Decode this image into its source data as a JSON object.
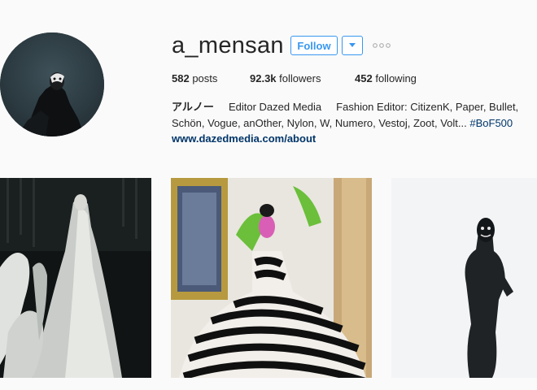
{
  "profile": {
    "username": "a_mensan",
    "follow_label": "Follow",
    "dropdown_icon": "chevron-down-icon",
    "more_icon": "ellipsis-icon"
  },
  "stats": {
    "posts_count": "582",
    "posts_label": "posts",
    "followers_count": "92.3k",
    "followers_label": "followers",
    "following_count": "452",
    "following_label": "following"
  },
  "bio": {
    "name": "アルノー",
    "line1_rest": "Editor Dazed Media     Fashion Editor: CitizenK, Paper, Bullet,",
    "line2_text": "Schön, Vogue, anOther, Nylon, W, Numero, Vestoj, Zoot, Volt...",
    "line2_tag": "#BoF500",
    "link": "www.dazedmedia.com/about"
  },
  "colors": {
    "accent": "#3897f0",
    "link": "#003569",
    "text": "#262626",
    "background": "#fafafa"
  }
}
